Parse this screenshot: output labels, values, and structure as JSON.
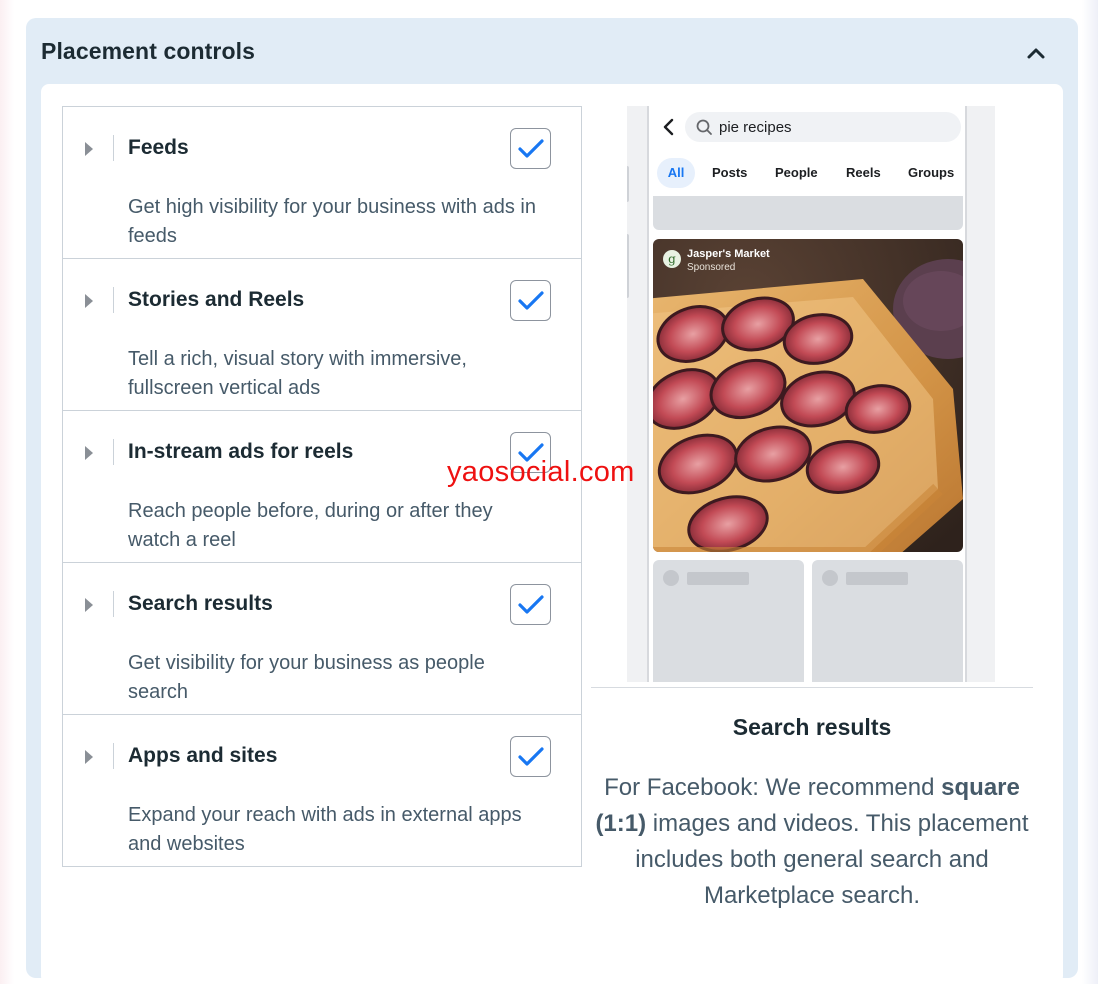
{
  "panel": {
    "title": "Placement controls"
  },
  "placements": [
    {
      "title": "Feeds",
      "description": "Get high visibility for your business with ads in feeds",
      "checked": true
    },
    {
      "title": "Stories and Reels",
      "description": "Tell a rich, visual story with immersive, fullscreen vertical ads",
      "checked": true
    },
    {
      "title": "In-stream ads for reels",
      "description": "Reach people before, during or after they watch a reel",
      "checked": true
    },
    {
      "title": "Search results",
      "description": "Get visibility for your business as people search",
      "checked": true
    },
    {
      "title": "Apps and sites",
      "description": "Expand your reach with ads in external apps and websites",
      "checked": true
    }
  ],
  "preview": {
    "search_query": "pie recipes",
    "tabs": [
      "All",
      "Posts",
      "People",
      "Reels",
      "Groups"
    ],
    "active_tab": "All",
    "ad": {
      "page_name": "Jasper's Market",
      "sponsored_label": "Sponsored",
      "avatar_letter": "g"
    },
    "title": "Search results",
    "desc_part1": "For Facebook: We recommend ",
    "desc_bold": "square (1:1)",
    "desc_part2": " images and videos. This placement includes both general search and Marketplace search."
  },
  "watermark": "yaosocial.com",
  "colors": {
    "accent": "#1877f2",
    "panel_bg": "#e1ecf6",
    "text": "#1c2b33",
    "muted_text": "#465a69",
    "border": "#cbd2d9"
  },
  "icons": {
    "collapse": "chevron-up-icon",
    "expand": "caret-right-icon",
    "checkbox": "check-icon",
    "back": "arrow-left-icon",
    "search": "search-icon"
  }
}
